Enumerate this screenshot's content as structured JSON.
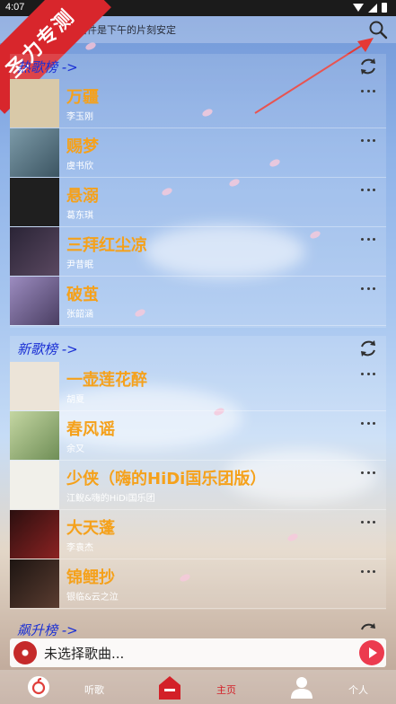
{
  "status_bar": {
    "time": "4:07"
  },
  "search": {
    "hint": "…旧倍件是下午的片刻安定"
  },
  "badge": {
    "text": "圣力专测"
  },
  "sections": [
    {
      "title": "热歌榜 ->",
      "songs": [
        {
          "title": "万疆",
          "artist": "李玉刚",
          "cover_color": "#d9c9a8"
        },
        {
          "title": "赐梦",
          "artist": "虞书欣",
          "cover_color": "#4d6a7d"
        },
        {
          "title": "悬溺",
          "artist": "葛东琪",
          "cover_color": "#1f1f1f"
        },
        {
          "title": "三拜红尘凉",
          "artist": "尹昔眠",
          "cover_color": "#3a3246"
        },
        {
          "title": "破茧",
          "artist": "张韶涵",
          "cover_color": "#6a5a7c"
        }
      ]
    },
    {
      "title": "新歌榜 ->",
      "songs": [
        {
          "title": "一壶莲花醉",
          "artist": "胡夏",
          "cover_color": "#e8e0d6"
        },
        {
          "title": "春风谣",
          "artist": "余又",
          "cover_color": "#9dbb7e"
        },
        {
          "title": "少侠（嗨的HiDi国乐团版）",
          "artist": "江鲵&嗨的HiDi国乐团",
          "cover_color": "#efefe8"
        },
        {
          "title": "大天蓬",
          "artist": "李袁杰",
          "cover_color": "#6b1d1d"
        },
        {
          "title": "锦鲤抄",
          "artist": "银临&云之泣",
          "cover_color": "#3b2a25"
        }
      ]
    },
    {
      "title": "飙升榜 ->"
    }
  ],
  "player": {
    "now_playing": "未选择歌曲..."
  },
  "nav": {
    "listen_label": "听歌",
    "home_label": "主页",
    "profile_label": "个人"
  },
  "colors": {
    "song_title": "#f5a11b",
    "section_title": "#1a2fd4",
    "badge": "#d8262c",
    "arrow": "#e53935",
    "play_button": "#ec3b4f"
  },
  "icons": {
    "search": "search-icon",
    "refresh": "refresh-icon",
    "more": "more-icon",
    "netease": "netease-logo-icon",
    "home": "home-icon",
    "profile": "person-icon"
  }
}
